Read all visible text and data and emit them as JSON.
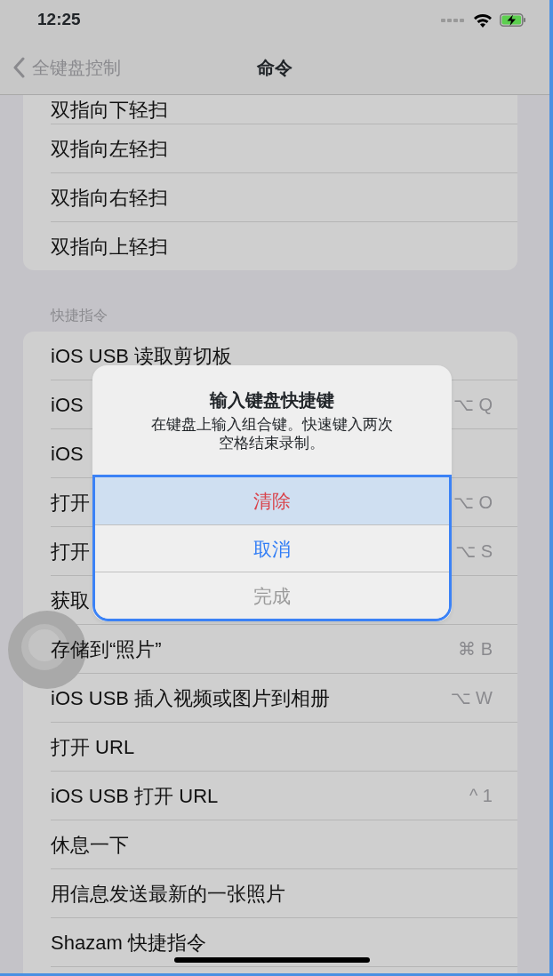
{
  "status_bar": {
    "time": "12:25"
  },
  "nav": {
    "back_label": "全键盘控制",
    "title": "命令"
  },
  "sections": [
    {
      "rows": [
        {
          "label": "双指向下轻扫"
        },
        {
          "label": "双指向左轻扫"
        },
        {
          "label": "双指向右轻扫"
        },
        {
          "label": "双指向上轻扫"
        }
      ]
    },
    {
      "header": "快捷指令",
      "rows": [
        {
          "label": "iOS USB 读取剪切板"
        },
        {
          "label": "iOS",
          "shortcut": "⌥ Q"
        },
        {
          "label": "iOS"
        },
        {
          "label": "打开",
          "shortcut": "⌥ O"
        },
        {
          "label": "打开",
          "shortcut": "⌥ S"
        },
        {
          "label": "获取"
        },
        {
          "label": "存储到“照片”",
          "shortcut": "⌘ B"
        },
        {
          "label": "iOS USB 插入视频或图片到相册",
          "shortcut": "⌥ W"
        },
        {
          "label": "打开 URL"
        },
        {
          "label": "iOS USB 打开 URL",
          "shortcut": "^ 1"
        },
        {
          "label": "休息一下"
        },
        {
          "label": "用信息发送最新的一张照片"
        },
        {
          "label": "Shazam 快捷指令"
        }
      ]
    }
  ],
  "dialog": {
    "title": "输入键盘快捷键",
    "message": "在键盘上输入组合键。快速键入两次空格结束录制。",
    "buttons": [
      {
        "label": "清除",
        "kind": "destructive",
        "selected": true,
        "disabled": false
      },
      {
        "label": "取消",
        "kind": "default",
        "selected": false,
        "disabled": false
      },
      {
        "label": "完成",
        "kind": "default",
        "selected": false,
        "disabled": true
      }
    ]
  }
}
